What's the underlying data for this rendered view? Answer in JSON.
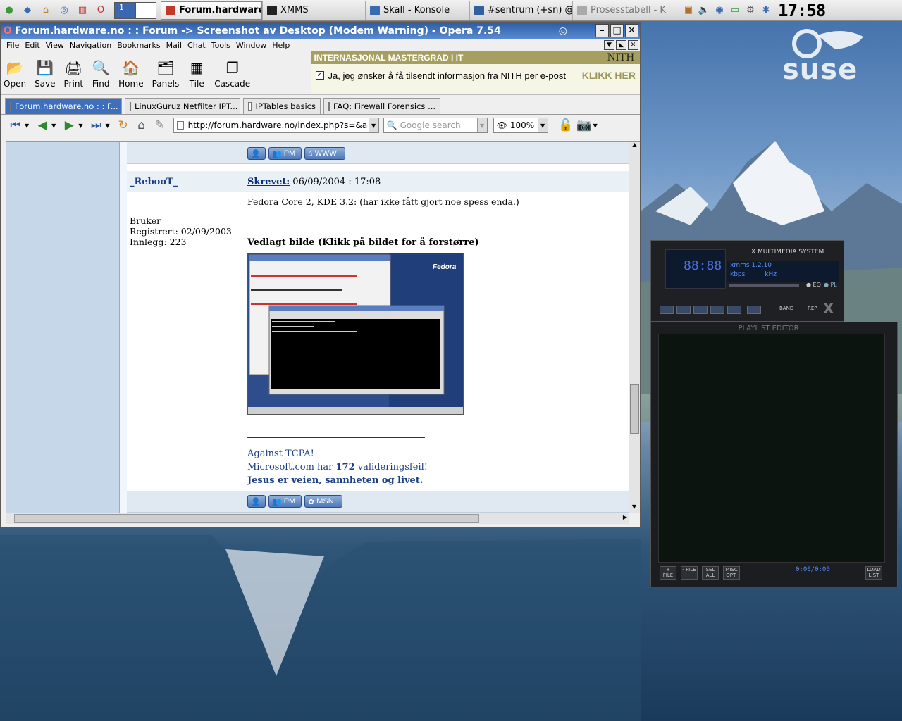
{
  "taskbar": {
    "pager": [
      "1",
      ""
    ],
    "tasks": [
      {
        "label": "Forum.hardware",
        "active": true,
        "color": "#c0392b"
      },
      {
        "label": "XMMS",
        "active": false,
        "color": "#222222"
      },
      {
        "label": "Skall - Konsole",
        "active": false,
        "color": "#3a6ab0"
      },
      {
        "label": "#sentrum (+sn) @",
        "active": false,
        "color": "#3060a0"
      },
      {
        "label": "Prosesstabell - K",
        "active": false,
        "color": "#7a7a7a"
      }
    ],
    "clock": "17:58"
  },
  "opera": {
    "title": "Forum.hardware.no : : Forum -> Screenshot av Desktop (Modem Warning) - Opera 7.54",
    "menu": [
      "File",
      "Edit",
      "View",
      "Navigation",
      "Bookmarks",
      "Mail",
      "Chat",
      "Tools",
      "Window",
      "Help"
    ],
    "toolbar": [
      {
        "label": "Open",
        "icon": "folder-icon",
        "glyph": "📂"
      },
      {
        "label": "Save",
        "icon": "floppy-icon",
        "glyph": "💾"
      },
      {
        "label": "Print",
        "icon": "printer-icon",
        "glyph": "🖨"
      },
      {
        "label": "Find",
        "icon": "magnifier-icon",
        "glyph": "🔍"
      },
      {
        "label": "Home",
        "icon": "house-icon",
        "glyph": "🏠"
      },
      {
        "label": "Panels",
        "icon": "panels-icon",
        "glyph": "🗂"
      },
      {
        "label": "Tile",
        "icon": "tile-icon",
        "glyph": "▦"
      },
      {
        "label": "Cascade",
        "icon": "cascade-icon",
        "glyph": "❐"
      }
    ],
    "banner": {
      "headline": "INTERNASJONAL MASTERGRAD I IT",
      "brand": "NITH",
      "checkbox_text": "Ja, jeg ønsker å få tilsendt informasjon fra NITH per e-post",
      "cta": "KLIKK HER"
    },
    "tabs": [
      {
        "label": "Forum.hardware.no : : F...",
        "active": true
      },
      {
        "label": "LinuxGuruz Netfilter IPT...",
        "active": false
      },
      {
        "label": "IPTables basics",
        "active": false
      },
      {
        "label": "FAQ: Firewall Forensics ...",
        "active": false
      }
    ],
    "address": {
      "url": "http://forum.hardware.no/index.php?s=&act=ST",
      "search_placeholder": "Google search",
      "zoom": "100%"
    }
  },
  "post": {
    "top_buttons": [
      "PM",
      "WWW"
    ],
    "author": "_RebooT_",
    "written_label": "Skrevet:",
    "written_date": "06/09/2004 : 17:08",
    "body": "Fedora Core 2, KDE 3.2: (har ikke fått gjort noe spess enda.)",
    "user_title": "Bruker",
    "registered": "Registrert: 02/09/2003",
    "posts": "Innlegg: 223",
    "attachment_label": "Vedlagt bilde (Klikk på bildet for å forstørre)",
    "thumb_brand": "Fedora",
    "signature": {
      "line1": "Against TCPA!",
      "line2_pre": "Microsoft.com har ",
      "line2_num": "172",
      "line2_post": " valideringsfeil!",
      "line3": "Jesus er veien, sannheten og livet."
    },
    "bottom_buttons": [
      "PM",
      "MSN"
    ]
  },
  "xmms": {
    "title": "X MULTIMEDIA SYSTEM",
    "version": "xmms 1.2.10",
    "kbps": "kbps",
    "khz": "kHz",
    "eq": "EQ",
    "pl": "PL",
    "band": "BAND",
    "rep": "REP",
    "playlist_title": "PLAYLIST EDITOR",
    "time": "0:00/0:00",
    "pl_buttons": [
      "+ FILE",
      "- FILE",
      "SEL ALL",
      "MISC OPT.",
      "LOAD LIST"
    ]
  }
}
